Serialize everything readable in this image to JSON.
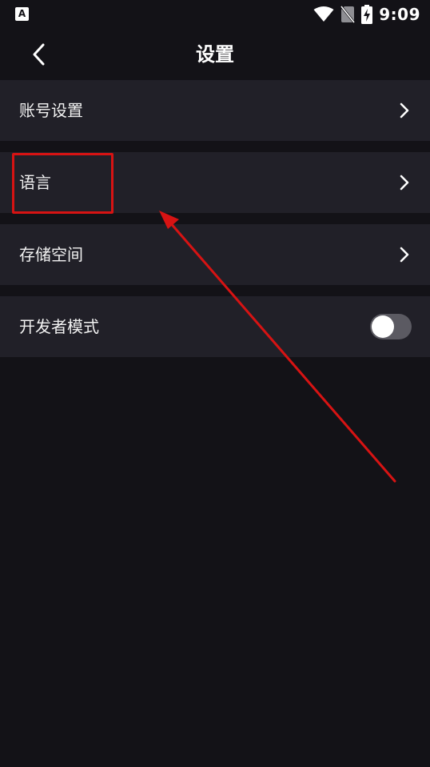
{
  "status_bar": {
    "left_icon": "A",
    "time": "9:09",
    "icons": [
      "wifi-icon",
      "no-sim-icon",
      "battery-charging-icon"
    ]
  },
  "header": {
    "title": "设置",
    "back_icon": "chevron-left-icon"
  },
  "settings": {
    "items": [
      {
        "label": "账号设置",
        "control": "chevron-right-icon"
      },
      {
        "label": "语言",
        "control": "chevron-right-icon"
      },
      {
        "label": "存储空间",
        "control": "chevron-right-icon"
      },
      {
        "label": "开发者模式",
        "control": "toggle",
        "toggle_on": false
      }
    ]
  },
  "annotation": {
    "highlight_color": "#d71313",
    "highlighted_item": "语言"
  },
  "colors": {
    "background": "#131217",
    "row_background": "#212028",
    "text": "#ffffff",
    "toggle_off_track": "#5b5a62"
  }
}
